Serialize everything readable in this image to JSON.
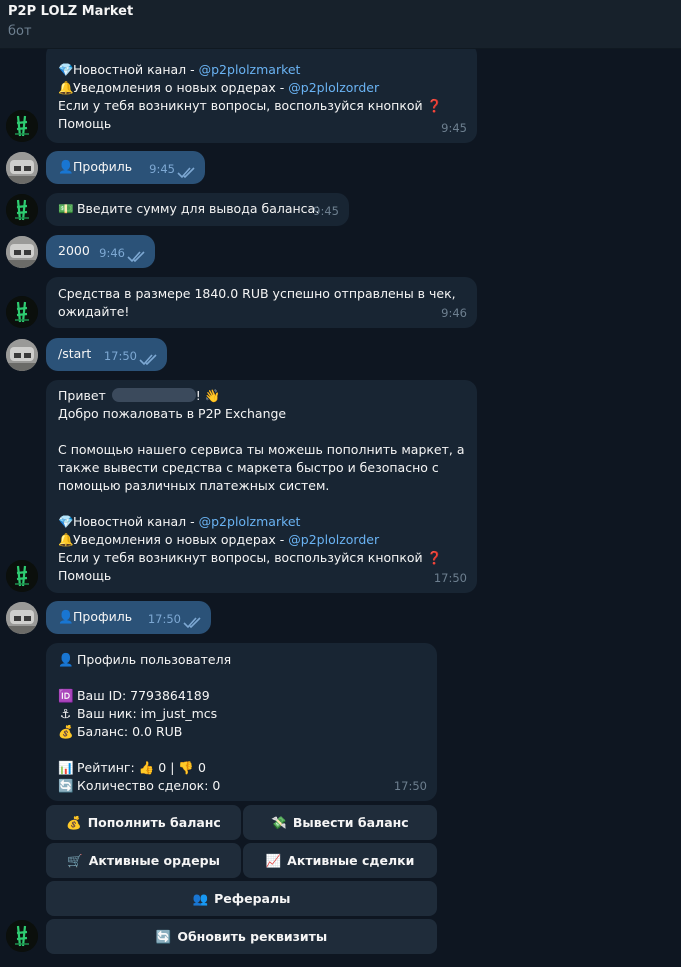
{
  "header": {
    "title": "P2P LOLZ Market",
    "subtitle": "бот"
  },
  "msg1": {
    "news_label": "Новостной канал - ",
    "news_link": "@p2plolzmarket",
    "notify_label": "Уведомления о новых ордерах - ",
    "notify_link": "@p2plolzorder",
    "question": "Если у тебя возникнут вопросы, воспользуйся кнопкой",
    "help": "Помощь",
    "time": "9:45"
  },
  "msg2": {
    "text": "Профиль",
    "time": "9:45"
  },
  "msg3": {
    "text": "Введите сумму для вывода баланса:",
    "time": "9:45"
  },
  "msg4": {
    "text": "2000",
    "time": "9:46"
  },
  "msg5": {
    "line1": "Средства в размере 1840.0 RUB успешно отправлены в чек,",
    "line2": "ожидайте!",
    "time": "9:46"
  },
  "msg6": {
    "text": "/start",
    "time": "17:50"
  },
  "msg7": {
    "greeting": "Привет",
    "greeting_end": "!",
    "welcome": "Добро пожаловать в P2P Exchange",
    "desc1": "С помощью нашего сервиса ты можешь пополнить маркет, а",
    "desc2": "также вывести средства с маркета быстро и безопасно с",
    "desc3": "помощью различных платежных систем.",
    "news_label": "Новостной канал - ",
    "news_link": "@p2plolzmarket",
    "notify_label": "Уведомления о новых ордерах - ",
    "notify_link": "@p2plolzorder",
    "question": "Если у тебя возникнут вопросы, воспользуйся кнопкой",
    "help": "Помощь",
    "time": "17:50"
  },
  "msg8": {
    "text": "Профиль",
    "time": "17:50"
  },
  "profile": {
    "title": "Профиль пользователя",
    "id_line": "Ваш ID: 7793864189",
    "nick_line": "Ваш ник: im_just_mcs",
    "balance_line": "Баланс: 0.0 RUB",
    "rating_label": "Рейтинг:",
    "likes": "0",
    "separator": "|",
    "dislikes": "0",
    "deals_line": "Количество сделок: 0",
    "time": "17:50"
  },
  "keyboard": {
    "deposit": "Пополнить баланс",
    "withdraw": "Вывести баланс",
    "orders": "Активные ордеры",
    "deals": "Активные сделки",
    "referrals": "Рефералы",
    "refresh": "Обновить реквизиты"
  },
  "colors": {
    "background": "#0e1621",
    "incoming_bubble": "#182533",
    "outgoing_bubble": "#2b5278",
    "link": "#6ab3f3",
    "header": "#17212b"
  },
  "icons": {
    "news": "gem-icon",
    "notify": "bell-icon",
    "help": "question-mark-icon",
    "profile": "bust-icon",
    "cash": "banknote-icon",
    "greeting": "waving-hand-icon",
    "id": "id-badge-icon",
    "nick": "anchor-icon",
    "balance": "money-bag-icon",
    "rating": "bar-chart-icon",
    "like": "thumbs-up-icon",
    "dislike": "thumbs-down-icon",
    "deals": "refresh-icon",
    "deposit": "money-bag-icon",
    "withdraw": "flying-money-icon",
    "orders": "cart-icon",
    "active_deals": "chart-up-icon",
    "referrals": "people-icon",
    "refresh": "refresh-icon"
  }
}
